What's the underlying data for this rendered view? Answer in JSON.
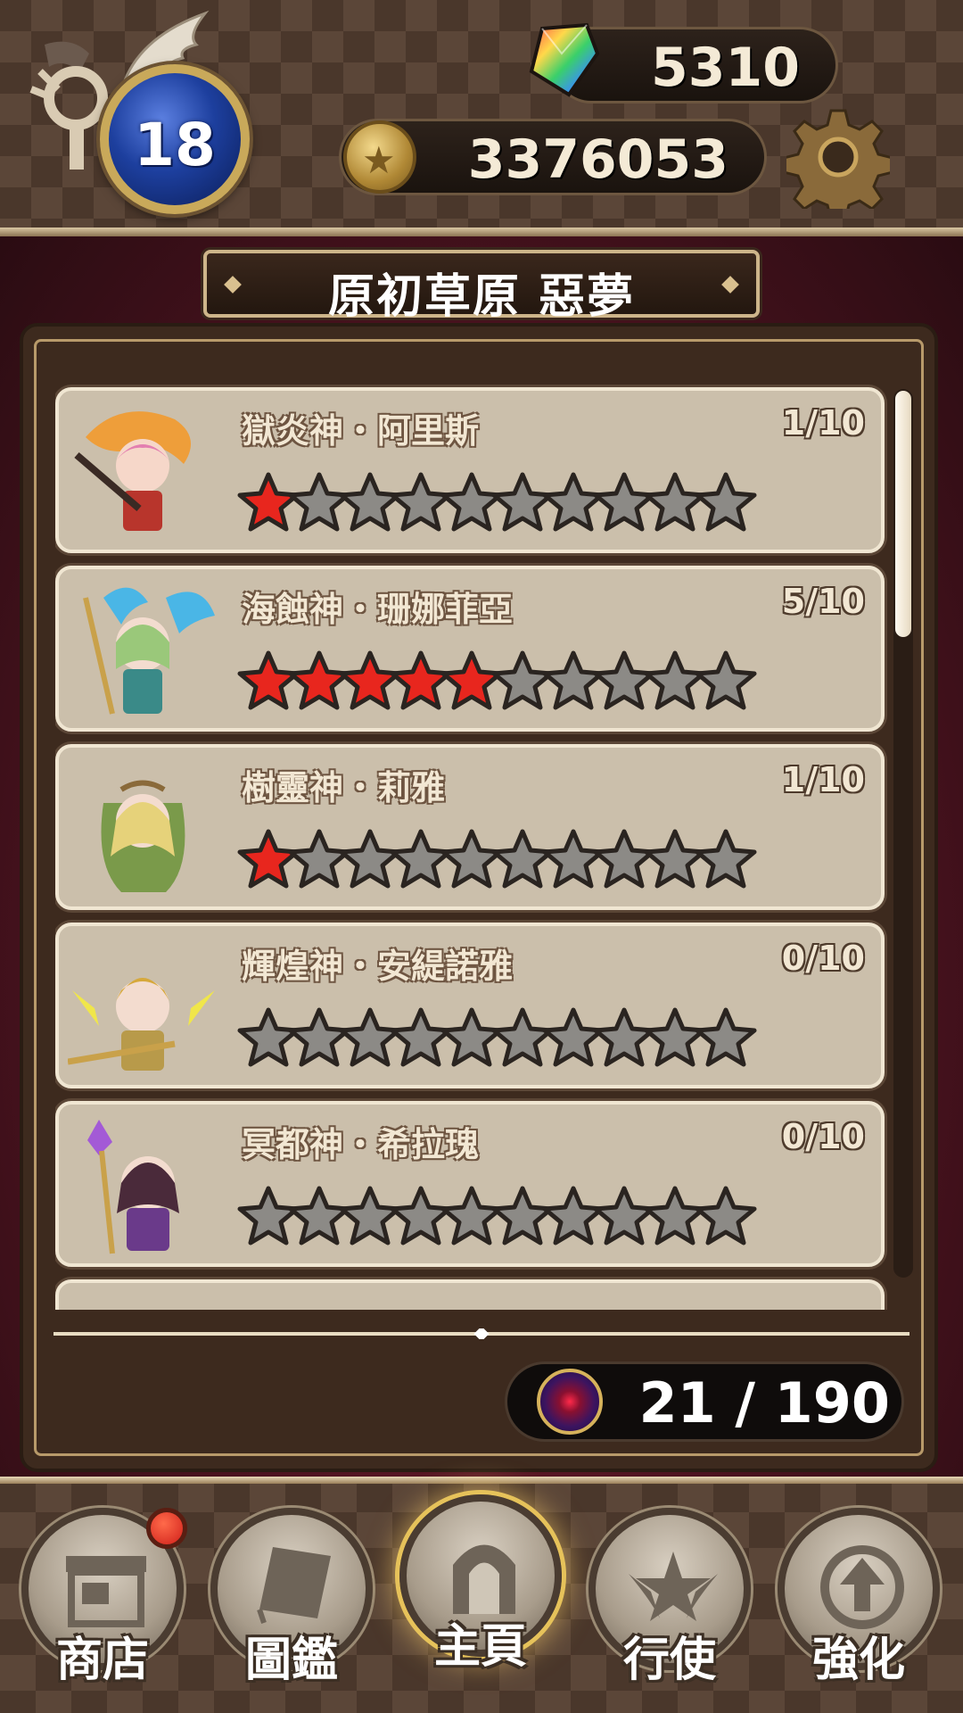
{
  "header": {
    "level": "18",
    "gems": "5310",
    "coins": "3376053"
  },
  "stage": {
    "title": "原初草原 惡夢"
  },
  "collection": {
    "entries": [
      {
        "name": "獄炎神・阿里斯",
        "count": "1/10",
        "filled": 1,
        "total": 10
      },
      {
        "name": "海蝕神・珊娜菲亞",
        "count": "5/10",
        "filled": 5,
        "total": 10
      },
      {
        "name": "樹靈神・莉雅",
        "count": "1/10",
        "filled": 1,
        "total": 10
      },
      {
        "name": "輝煌神・安緹諾雅",
        "count": "0/10",
        "filled": 0,
        "total": 10
      },
      {
        "name": "冥都神・希拉瑰",
        "count": "0/10",
        "filled": 0,
        "total": 10
      }
    ],
    "progress": "21 / 190"
  },
  "nav": {
    "shop": "商店",
    "codex": "圖鑑",
    "home": "主頁",
    "execute": "行使",
    "upgrade": "強化",
    "active": "home"
  },
  "colors": {
    "star_filled": "#e8261e",
    "star_empty": "#8c8a86",
    "accent_gold": "#d6b25b"
  }
}
